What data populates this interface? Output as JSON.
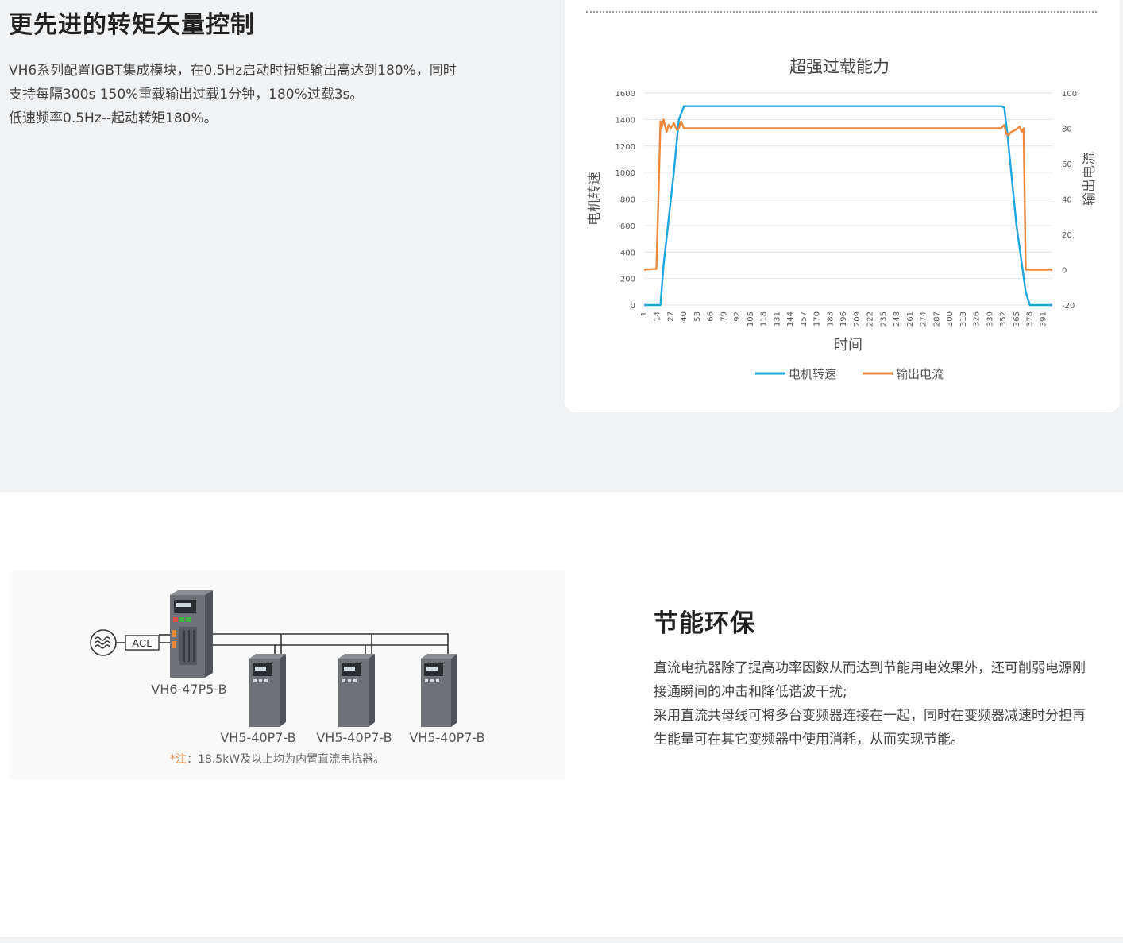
{
  "feature1": {
    "title": "更先进的转矩矢量控制",
    "lines": [
      "VH6系列配置IGBT集成模块，在0.5Hz启动时扭矩输出高达到180%，同时",
      "支持每隔300s 150%重载输出过载1分钟，180%过载3s。",
      "低速频率0.5Hz--起动转矩180%。"
    ]
  },
  "chart_data": {
    "type": "line",
    "title": "超强过载能力",
    "xlabel": "时间",
    "ylabel_left": "电机转速",
    "ylabel_right": "输出电流",
    "ylim_left": [
      0,
      1600
    ],
    "ylim_right": [
      -20,
      100
    ],
    "yticks_left": [
      "0",
      "200",
      "400",
      "600",
      "800",
      "1000",
      "1200",
      "1400",
      "1600"
    ],
    "yticks_right": [
      "-20",
      "0",
      "20",
      "40",
      "60",
      "80",
      "100"
    ],
    "xticks": [
      "1",
      "14",
      "27",
      "40",
      "53",
      "66",
      "79",
      "92",
      "105",
      "118",
      "131",
      "144",
      "157",
      "170",
      "183",
      "196",
      "209",
      "222",
      "235",
      "248",
      "261",
      "274",
      "287",
      "300",
      "313",
      "326",
      "339",
      "352",
      "365",
      "378",
      "391"
    ],
    "x_range": [
      1,
      400
    ],
    "grid": true,
    "legend_position": "bottom",
    "series": [
      {
        "name": "电机转速",
        "axis": "left",
        "color": "#1ba7e0",
        "x": [
          1,
          17,
          20,
          30,
          35,
          40,
          100,
          200,
          300,
          350,
          353,
          356,
          365,
          374,
          378,
          382,
          400
        ],
        "y": [
          0,
          0,
          300,
          1000,
          1400,
          1500,
          1500,
          1500,
          1500,
          1500,
          1490,
          1300,
          600,
          100,
          0,
          0,
          0
        ]
      },
      {
        "name": "输出电流",
        "axis": "right",
        "color": "#f0883c",
        "x": [
          1,
          13,
          15,
          17,
          18,
          20,
          23,
          25,
          27,
          30,
          33,
          35,
          37,
          40,
          100,
          200,
          300,
          350,
          353,
          355,
          357,
          360,
          364,
          368,
          370,
          372,
          374,
          400
        ],
        "y": [
          0,
          0.5,
          40,
          84,
          80,
          85,
          78,
          82,
          80,
          83,
          79,
          80,
          84,
          80,
          80,
          80,
          80,
          80,
          82,
          77,
          76,
          78,
          79,
          81,
          78,
          80,
          0,
          0
        ]
      }
    ]
  },
  "feature2": {
    "title": "节能环保",
    "lines": [
      "直流电抗器除了提高功率因数从而达到节能用电效果外，还可削弱电源刚",
      "接通瞬间的冲击和降低谐波干扰;",
      "采用直流共母线可将多台变频器连接在一起，同时在变频器减速时分担再",
      "生能量可在其它变频器中使用消耗，从而实现节能。"
    ]
  },
  "diagram": {
    "acl_label": "ACL",
    "main_model": "VH6-47P5-B",
    "sub_models": [
      "VH5-40P7-B",
      "VH5-40P7-B",
      "VH5-40P7-B"
    ],
    "note_star": "*注",
    "note_text": "：18.5kW及以上均为内置直流电抗器。",
    "accent_color": "#f0883c"
  }
}
